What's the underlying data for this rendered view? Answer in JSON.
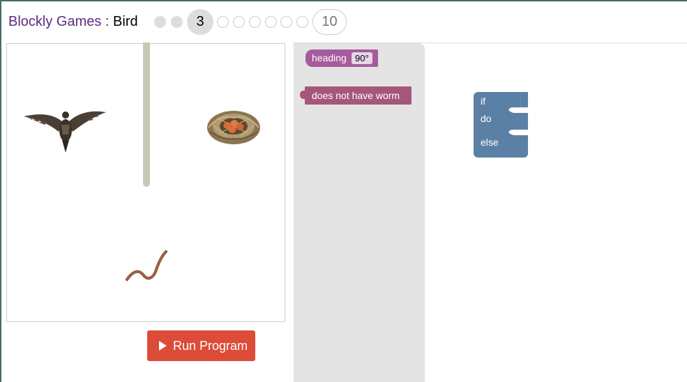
{
  "header": {
    "app_title": "Blockly Games",
    "separator": " : ",
    "game_title": "Bird",
    "levels": {
      "current_label": "3",
      "last_label": "10",
      "current": 3,
      "total": 10,
      "completed": 2
    }
  },
  "visualization": {
    "wall_color": "#c8c8b9"
  },
  "controls": {
    "run_label": "Run Program",
    "run_color": "#dd4b39"
  },
  "toolbox": {
    "heading_block": {
      "label": "heading",
      "value": "90°",
      "color": "#a55b9e"
    },
    "condition_block": {
      "label": "does not have worm",
      "color": "#a5577b"
    }
  },
  "workspace": {
    "if_block": {
      "if_label": "if",
      "do_label": "do",
      "else_label": "else",
      "color": "#5b80a5"
    }
  }
}
